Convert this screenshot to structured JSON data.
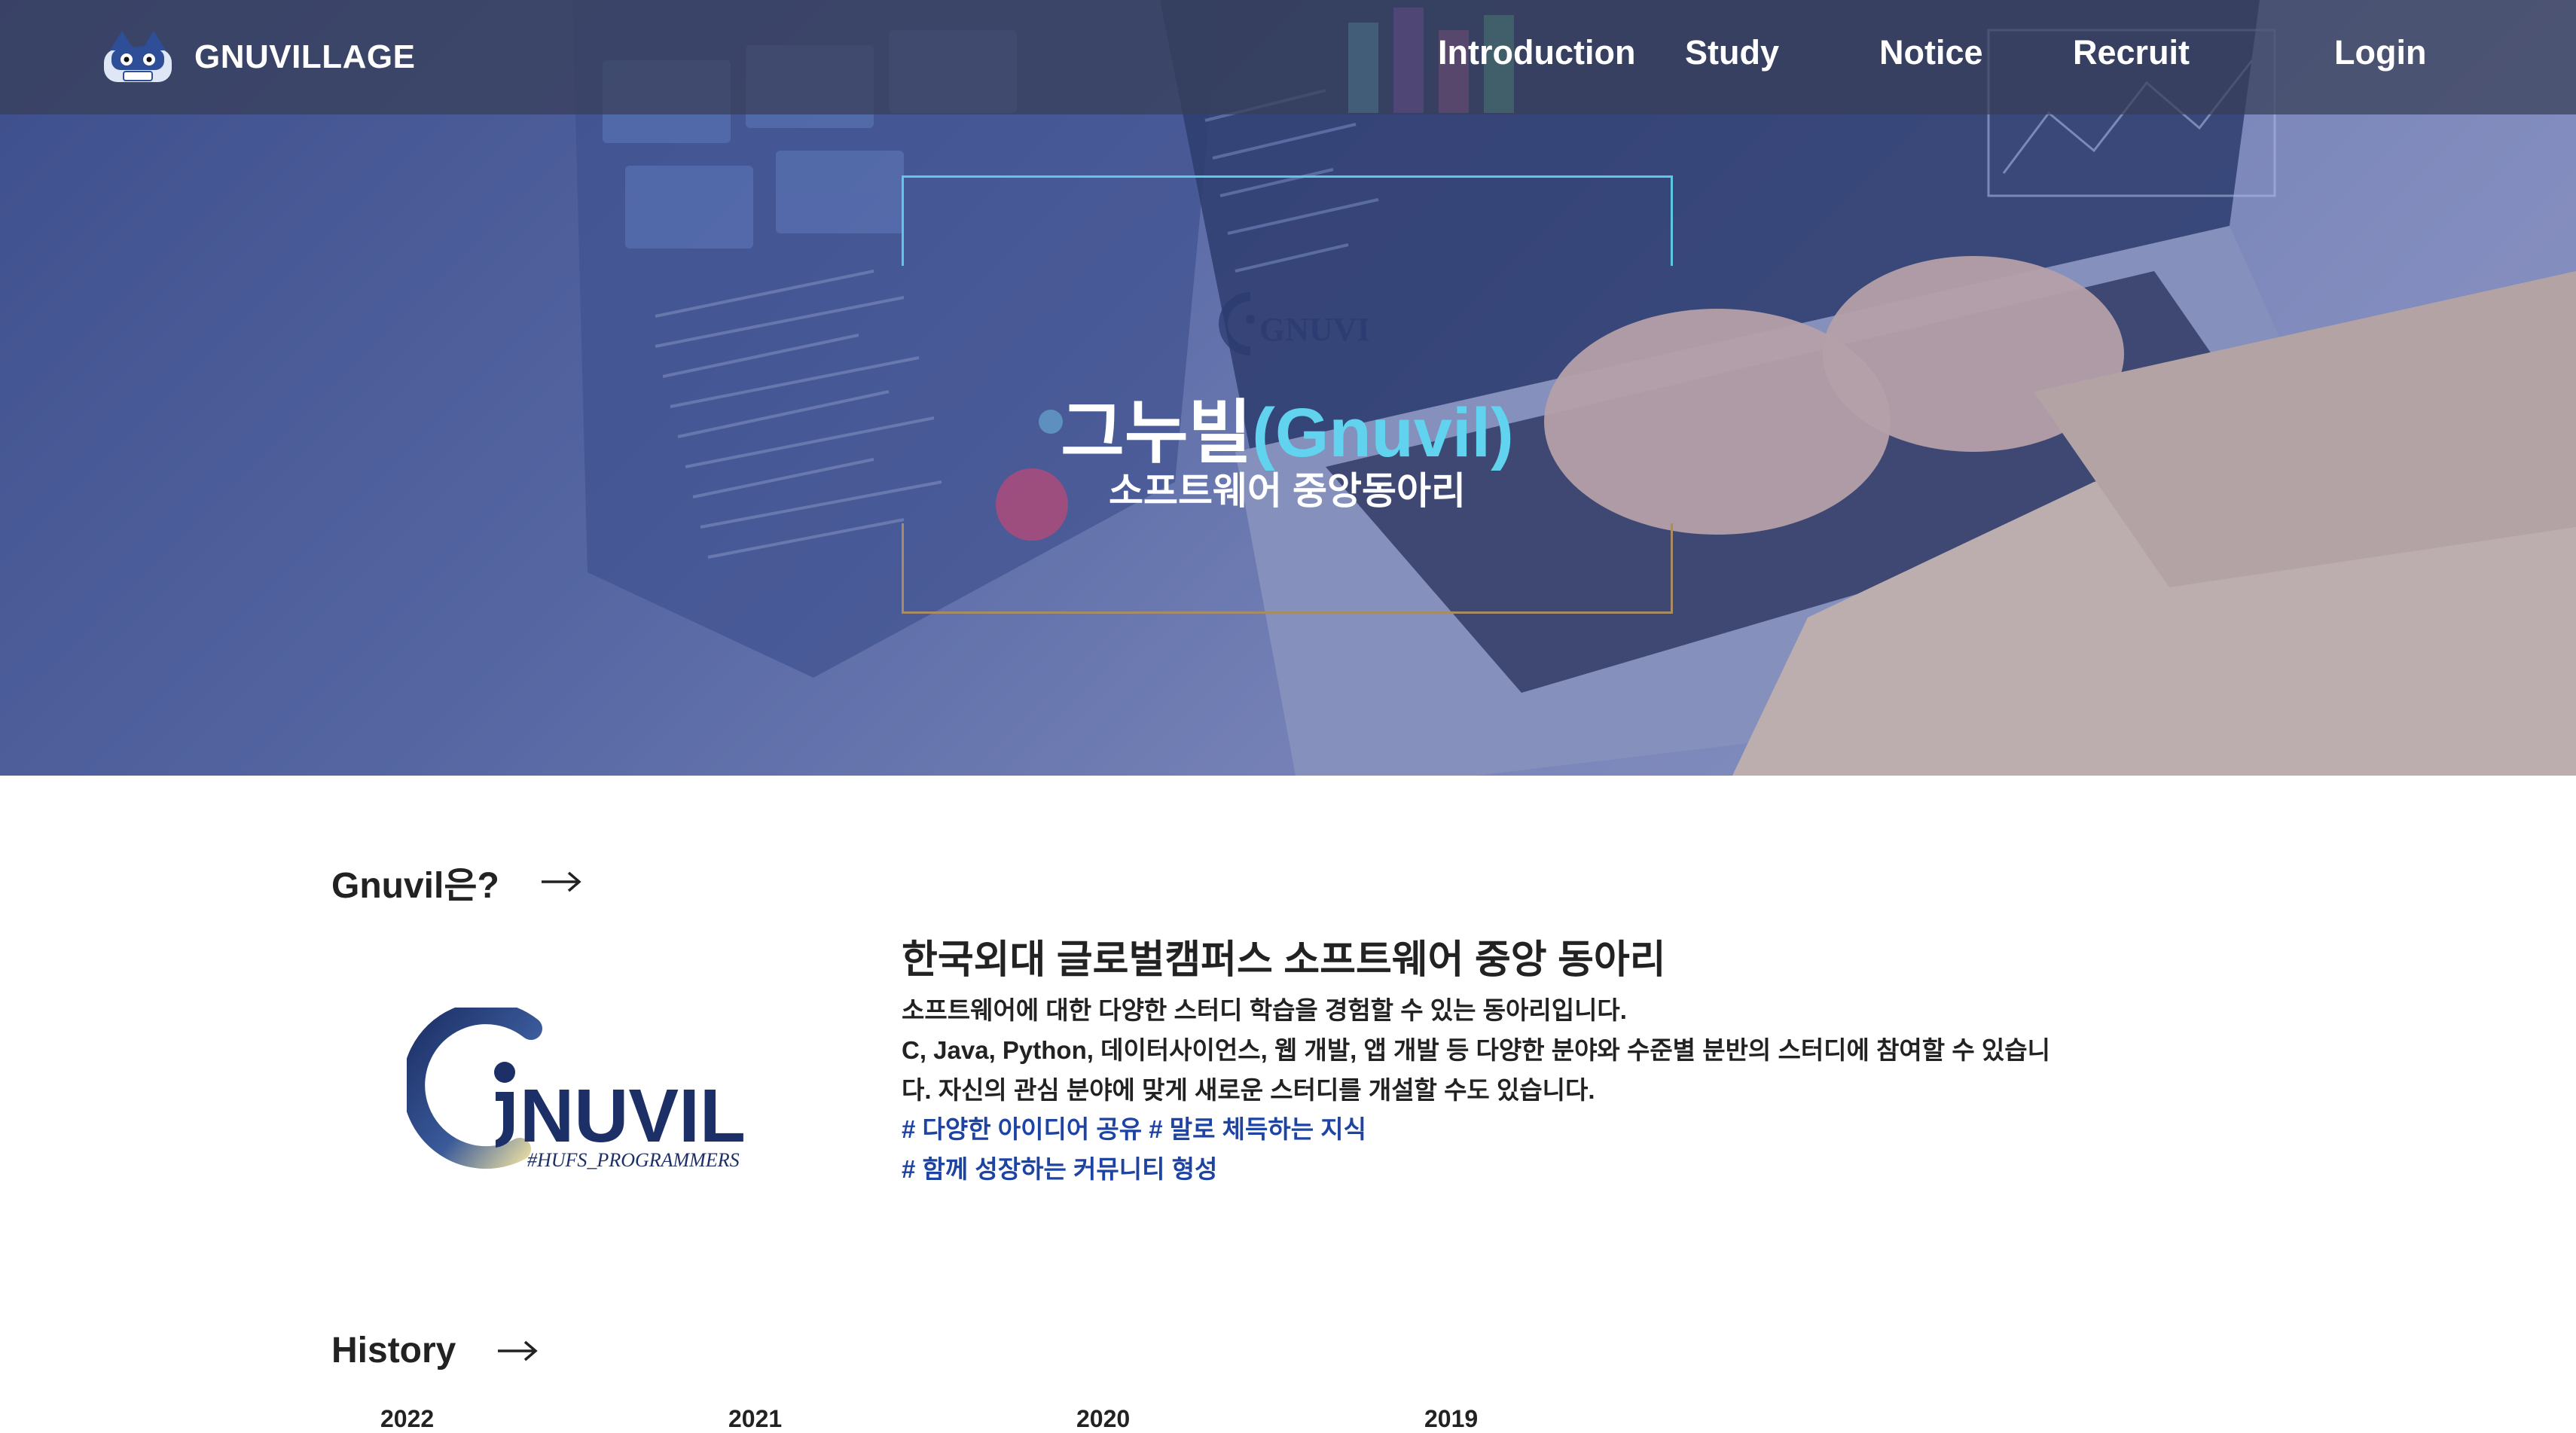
{
  "navbar": {
    "brand": "GNUVILLAGE",
    "items": [
      "Introduction",
      "Study",
      "Notice",
      "Recruit",
      "Login"
    ]
  },
  "hero": {
    "emblem_text": "GNUVIL",
    "title_korean": "그누빌",
    "title_english": "(Gnuvil)",
    "subtitle": "소프트웨어 중앙동아리"
  },
  "about": {
    "heading": "Gnuvil은?",
    "logo_text": "NUVIL",
    "logo_tagline": "#HUFS_PROGRAMMERS",
    "title": "한국외대 글로벌캠퍼스 소프트웨어 중앙 동아리",
    "body_lines": [
      "소프트웨어에 대한 다양한 스터디 학습을 경험할 수 있는 동아리입니다.",
      "C, Java, Python, 데이터사이언스, 웹 개발, 앱 개발 등 다양한 분야와 수준별 분반의 스터디에 참여할 수 있습니",
      "다. 자신의 관심 분야에 맞게 새로운 스터디를 개설할 수도 있습니다."
    ],
    "hashtags": [
      "# 다양한 아이디어 공유 # 말로 체득하는 지식",
      "# 함께 성장하는 커뮤니티 형성"
    ]
  },
  "history": {
    "heading": "History",
    "years": [
      "2022",
      "2021",
      "2020",
      "2019"
    ]
  },
  "colors": {
    "accent_cyan": "#61d3ee",
    "hashtag_blue": "#1d43a3",
    "navbar_bg": "#373e58"
  }
}
